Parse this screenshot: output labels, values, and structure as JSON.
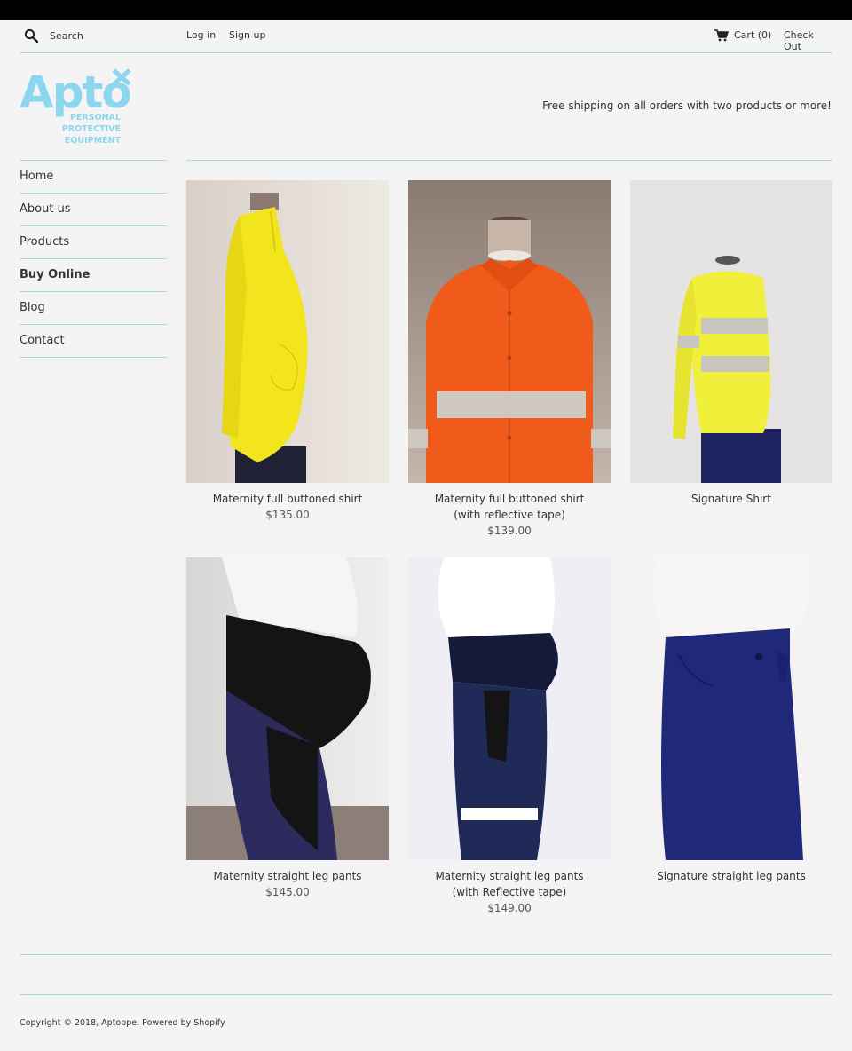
{
  "header": {
    "search_placeholder": "Search",
    "login": "Log in",
    "signup": "Sign up",
    "cart": "Cart (0)",
    "checkout": "Check Out"
  },
  "logo": {
    "wordmark": "Apto",
    "line1": "PERSONAL",
    "line2": "PROTECTIVE",
    "line3": "EQUIPMENT"
  },
  "tagline": "Free shipping on all orders with two products or more!",
  "nav": {
    "items": [
      {
        "label": "Home"
      },
      {
        "label": "About us"
      },
      {
        "label": "Products"
      },
      {
        "label": "Buy Online"
      },
      {
        "label": "Blog"
      },
      {
        "label": "Contact"
      }
    ]
  },
  "products": [
    {
      "name": "Maternity full buttoned shirt",
      "price": "$135.00"
    },
    {
      "name": "Maternity full buttoned shirt (with reflective tape)",
      "price": "$139.00"
    },
    {
      "name": "Signature Shirt",
      "price": ""
    },
    {
      "name": "Maternity straight leg pants",
      "price": "$145.00"
    },
    {
      "name": "Maternity straight leg pants (with Reflective tape)",
      "price": "$149.00"
    },
    {
      "name": "Signature straight leg pants",
      "price": ""
    }
  ],
  "footer": {
    "copyright": "Copyright © 2018, Aptoppe. Powered by Shopify"
  },
  "colors": {
    "accent_rule": "#a8dae8",
    "logo_blue": "#8dd6f0",
    "background": "#f4f4f4"
  }
}
